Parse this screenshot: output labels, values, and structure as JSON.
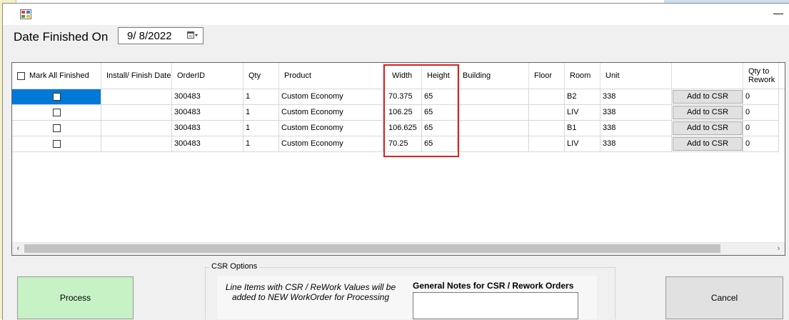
{
  "date_finished": {
    "label": "Date Finished On",
    "value": "9/  8/2022"
  },
  "grid": {
    "columns": {
      "mark_all": "Mark All Finished",
      "install_finish_date": "Install/ Finish Date",
      "order_id": "OrderID",
      "qty": "Qty",
      "product": "Product",
      "width": "Width",
      "height": "Height",
      "building": "Building",
      "floor": "Floor",
      "room": "Room",
      "unit": "Unit",
      "csr": "",
      "qty_to_rework": "Qty to Rework"
    },
    "rows": [
      {
        "order_id": "300483",
        "qty": "1",
        "product": "Custom Economy",
        "width": "70.375",
        "height": "65",
        "building": "",
        "floor": "",
        "room": "B2",
        "unit": "338",
        "csr_button": "Add to CSR",
        "qty_to_rework": "0"
      },
      {
        "order_id": "300483",
        "qty": "1",
        "product": "Custom Economy",
        "width": "106.25",
        "height": "65",
        "building": "",
        "floor": "",
        "room": "LIV",
        "unit": "338",
        "csr_button": "Add to CSR",
        "qty_to_rework": "0"
      },
      {
        "order_id": "300483",
        "qty": "1",
        "product": "Custom Economy",
        "width": "106.625",
        "height": "65",
        "building": "",
        "floor": "",
        "room": "B1",
        "unit": "338",
        "csr_button": "Add to CSR",
        "qty_to_rework": "0"
      },
      {
        "order_id": "300483",
        "qty": "1",
        "product": "Custom Economy",
        "width": "70.25",
        "height": "65",
        "building": "",
        "floor": "",
        "room": "LIV",
        "unit": "338",
        "csr_button": "Add to CSR",
        "qty_to_rework": "0"
      }
    ]
  },
  "buttons": {
    "process": "Process",
    "cancel": "Cancel"
  },
  "csr": {
    "group_label": "CSR Options",
    "info_text": "Line Items with CSR / ReWork Values will be added to NEW WorkOrder for Processing",
    "notes_label": "General Notes for CSR / Rework Orders"
  },
  "colors": {
    "selection": "#0078d7",
    "process_bg": "#c6f2c6",
    "highlight": "#e02020"
  }
}
